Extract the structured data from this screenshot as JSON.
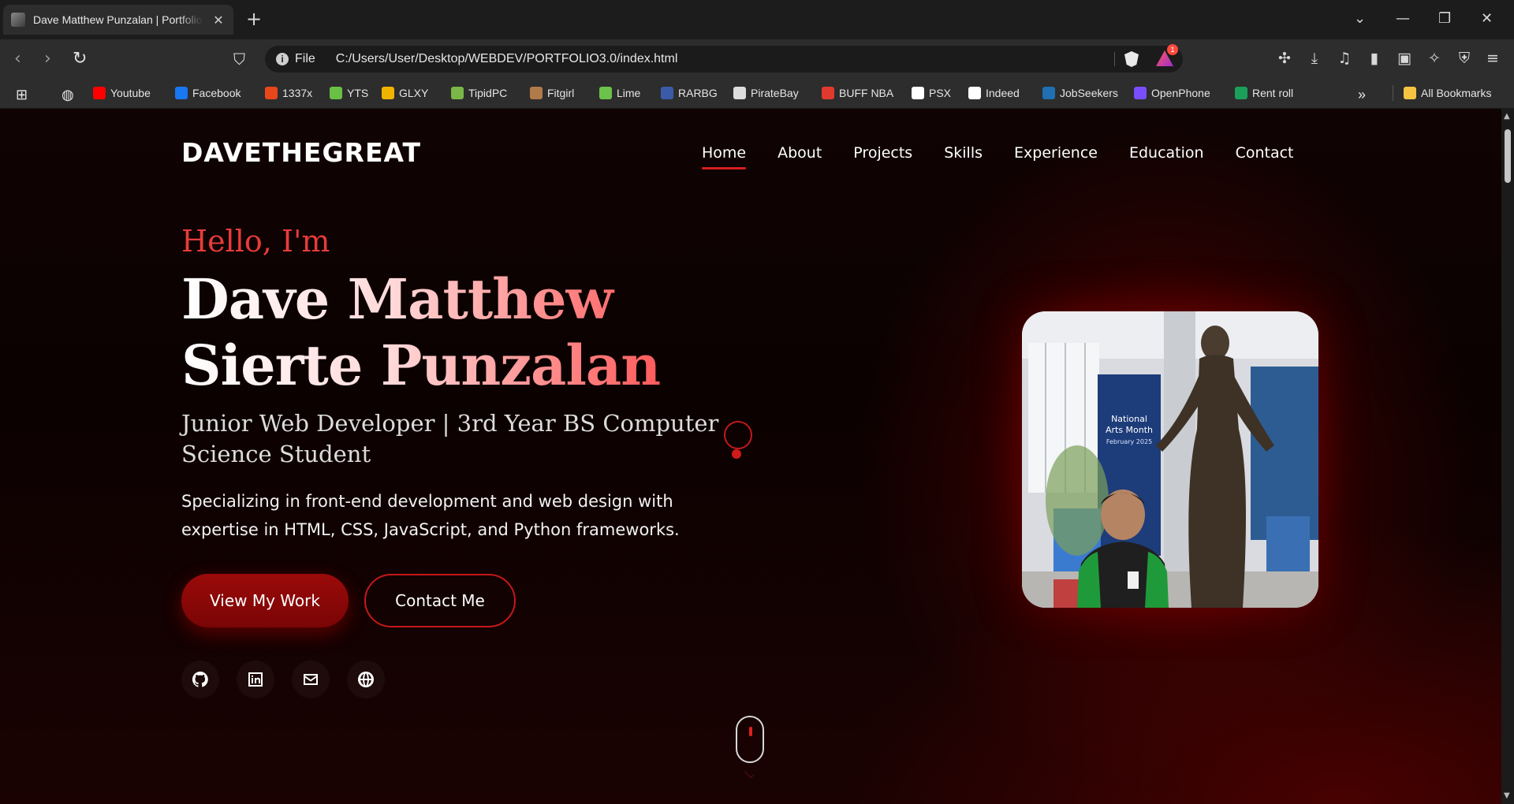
{
  "browser": {
    "tab_title": "Dave Matthew Punzalan | Portfolio",
    "tab_close": "✕",
    "new_tab": "+",
    "scheme_label": "File",
    "url": "C:/Users/User/Desktop/WEBDEV/PORTFOLIO3.0/index.html",
    "rewards_badge": "1",
    "bookmarks": [
      {
        "label": "Youtube",
        "color": "#ff0000"
      },
      {
        "label": "Facebook",
        "color": "#1877f2"
      },
      {
        "label": "1337x",
        "color": "#e8471c"
      },
      {
        "label": "YTS",
        "color": "#6ac045"
      },
      {
        "label": "GLXY",
        "color": "#f0b400"
      },
      {
        "label": "TipidPC",
        "color": "#7ab648"
      },
      {
        "label": "Fitgirl",
        "color": "#b07a4a"
      },
      {
        "label": "Lime",
        "color": "#6cc24a"
      },
      {
        "label": "RARBG",
        "color": "#3b5ba9"
      },
      {
        "label": "PirateBay",
        "color": "#dddddd"
      },
      {
        "label": "BUFF NBA",
        "color": "#e03a2f"
      },
      {
        "label": "PSX",
        "color": "#ffffff"
      },
      {
        "label": "Indeed",
        "color": "#ffffff"
      },
      {
        "label": "JobSeekers",
        "color": "#1f6fb2"
      },
      {
        "label": "OpenPhone",
        "color": "#7a4dff"
      },
      {
        "label": "Rent roll",
        "color": "#1aa05a"
      }
    ],
    "all_bookmarks": "All Bookmarks"
  },
  "site": {
    "logo": "DAVETHEGREAT",
    "nav": [
      "Home",
      "About",
      "Projects",
      "Skills",
      "Experience",
      "Education",
      "Contact"
    ],
    "active_nav": "Home"
  },
  "hero": {
    "greeting": "Hello, I'm",
    "name": "Dave Matthew Sierte Punzalan",
    "role": "Junior Web Developer | 3rd Year BS Computer Science Student",
    "description": "Specializing in front-end development and web design with expertise in HTML, CSS, JavaScript, and Python frameworks.",
    "primary_button": "View My Work",
    "secondary_button": "Contact Me",
    "socials": [
      "github-icon",
      "linkedin-icon",
      "mail-icon",
      "globe-icon"
    ]
  },
  "photo": {
    "banner_text": "National Arts Month",
    "banner_subtext": "February 2025"
  },
  "colors": {
    "accent": "#d81e1e",
    "greeting": "#e83b3b",
    "button_primary": "#8b0808"
  }
}
